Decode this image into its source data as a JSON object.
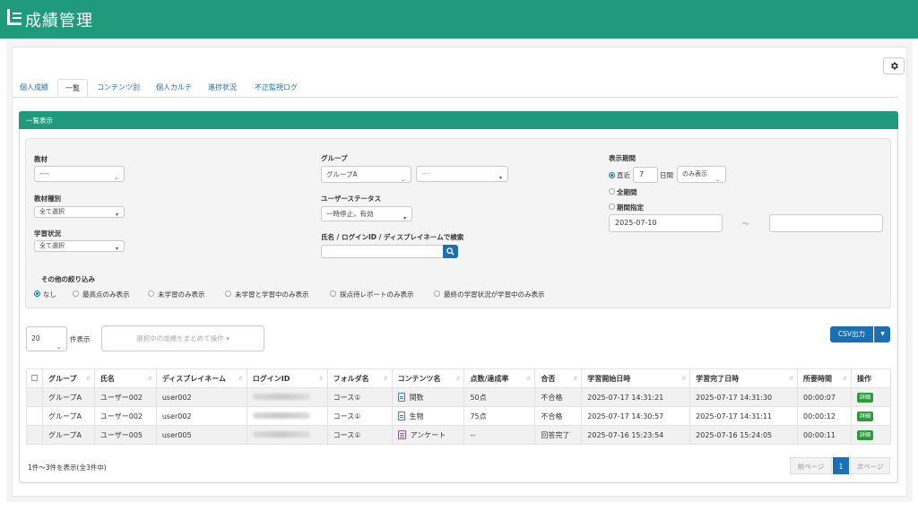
{
  "app": {
    "title": "成績管理"
  },
  "tabs": [
    {
      "label": "個人成績"
    },
    {
      "label": "一覧"
    },
    {
      "label": "コンテンツ別"
    },
    {
      "label": "個人カルテ"
    },
    {
      "label": "進捗状況"
    },
    {
      "label": "不正監視ログ"
    }
  ],
  "panel": {
    "title": "一覧表示"
  },
  "filters": {
    "material_label": "教材",
    "material_value": "----",
    "material_type_label": "教材種別",
    "material_type_value": "全て選択",
    "study_status_label": "学習状況",
    "study_status_value": "全て選択",
    "group_label": "グループ",
    "group_value": "グループA",
    "group_sub_value": "----",
    "user_status_label": "ユーザーステータス",
    "user_status_value": "一時停止，有効",
    "search_label": "氏名 / ログインID / ディスプレイネームで検索",
    "search_value": "",
    "period_label": "表示期間",
    "period_recent_prefix": "直近",
    "period_recent_days": "7",
    "period_recent_unit": "日間",
    "period_recent_mode": "のみ表示",
    "period_all": "全期間",
    "period_range": "期間指定",
    "date_from": "2025-07-10",
    "date_sep": "～",
    "date_to": "",
    "other_label": "その他の絞り込み",
    "other_options": [
      "なし",
      "最高点のみ表示",
      "未学習のみ表示",
      "未学習と学習中のみ表示",
      "採点待レポートのみ表示",
      "最終の学習状況が学習中のみ表示"
    ]
  },
  "toolbar": {
    "page_size": "20",
    "page_size_unit": "件表示",
    "bulk_label": "選択中の成績をまとめて操作",
    "csv_label": "CSV出力"
  },
  "table": {
    "headers": [
      "グループ",
      "氏名",
      "ディスプレイネーム",
      "ログインID",
      "フォルダ名",
      "コンテンツ名",
      "点数/達成率",
      "合否",
      "学習開始日時",
      "学習完了日時",
      "所要時間",
      "操作"
    ],
    "rows": [
      {
        "group": "グループA",
        "name": "ユーザー002",
        "display": "user002",
        "folder": "コース①",
        "content": "関数",
        "content_type": "file",
        "score": "50点",
        "result": "不合格",
        "start": "2025-07-17 14:31:21",
        "end": "2025-07-17 14:31:30",
        "duration": "00:00:07",
        "action": "詳細"
      },
      {
        "group": "グループA",
        "name": "ユーザー002",
        "display": "user002",
        "folder": "コース①",
        "content": "生物",
        "content_type": "file",
        "score": "75点",
        "result": "不合格",
        "start": "2025-07-17 14:30:57",
        "end": "2025-07-17 14:31:11",
        "duration": "00:00:12",
        "action": "詳細"
      },
      {
        "group": "グループA",
        "name": "ユーザー005",
        "display": "user005",
        "folder": "コース①",
        "content": "アンケート",
        "content_type": "survey",
        "score": "--",
        "result": "回答完了",
        "start": "2025-07-16 15:23:54",
        "end": "2025-07-16 15:24:05",
        "duration": "00:00:11",
        "action": "詳細"
      }
    ]
  },
  "footer": {
    "summary": "1件～3件を表示(全3件中)",
    "prev": "前ページ",
    "current": "1",
    "next": "次ページ"
  },
  "colors": {
    "brand": "#1f9a7c",
    "primary": "#1a6fb5",
    "success": "#2a9b3b"
  }
}
